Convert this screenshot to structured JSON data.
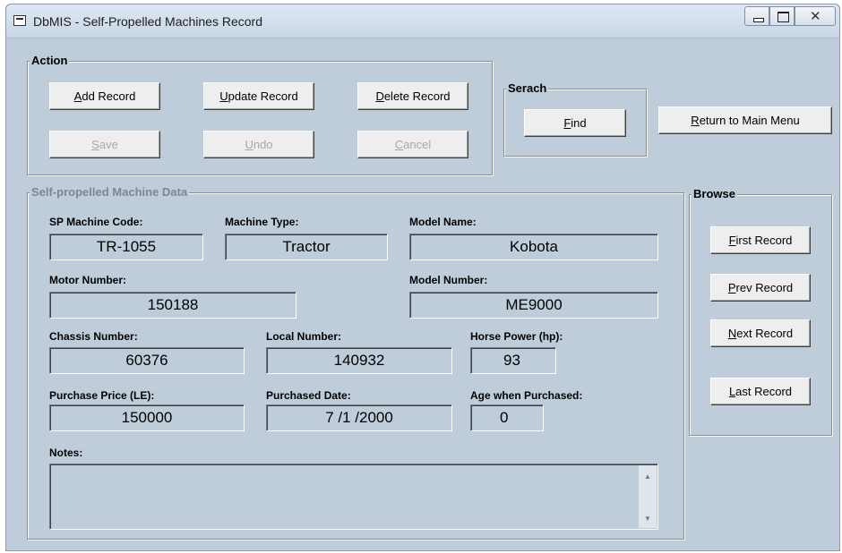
{
  "window": {
    "title": "DbMIS - Self-Propelled Machines Record"
  },
  "action_group": {
    "label": "Action",
    "buttons": {
      "add": {
        "mnemonic": "A",
        "rest": "dd Record"
      },
      "update": {
        "mnemonic": "U",
        "rest": "pdate Record"
      },
      "delete": {
        "mnemonic": "D",
        "rest": "elete Record"
      },
      "save": {
        "mnemonic": "S",
        "rest": "ave"
      },
      "undo": {
        "mnemonic": "U",
        "rest": "ndo"
      },
      "cancel": {
        "mnemonic": "C",
        "rest": "ancel"
      }
    }
  },
  "search_group": {
    "label": "Serach",
    "find": {
      "mnemonic": "F",
      "rest": "ind"
    }
  },
  "return_button": {
    "mnemonic": "R",
    "rest": "eturn to Main Menu"
  },
  "data_group": {
    "label": "Self-propelled Machine Data",
    "fields": {
      "sp_code": {
        "label": "SP Machine Code:",
        "value": "TR-1055"
      },
      "machine_type": {
        "label": "Machine Type:",
        "value": "Tractor"
      },
      "model_name": {
        "label": "Model Name:",
        "value": "Kobota"
      },
      "motor_number": {
        "label": "Motor Number:",
        "value": "150188"
      },
      "model_number": {
        "label": "Model Number:",
        "value": "ME9000"
      },
      "chassis_number": {
        "label": "Chassis Number:",
        "value": "60376"
      },
      "local_number": {
        "label": "Local Number:",
        "value": "140932"
      },
      "horse_power": {
        "label": "Horse Power (hp):",
        "value": "93"
      },
      "purchase_price": {
        "label": "Purchase Price (LE):",
        "value": "150000"
      },
      "purchased_date": {
        "label": "Purchased Date:",
        "value": "7 /1 /2000"
      },
      "age_purchased": {
        "label": "Age when Purchased:",
        "value": "0"
      },
      "notes": {
        "label": "Notes:",
        "value": ""
      }
    }
  },
  "browse_group": {
    "label": "Browse",
    "first": {
      "mnemonic": "F",
      "rest": "irst Record"
    },
    "prev": {
      "mnemonic": "P",
      "rest": "rev Record"
    },
    "next": {
      "mnemonic": "N",
      "rest": "ext Record"
    },
    "last": {
      "mnemonic": "L",
      "rest": "ast Record"
    }
  },
  "colors": {
    "window_bg": "#bfcddb",
    "button_face": "#eeeeee",
    "disabled_text": "#a8a8a8"
  },
  "icons": [
    "app-icon",
    "minimize-icon",
    "maximize-icon",
    "close-icon",
    "scroll-up-icon",
    "scroll-down-icon"
  ]
}
